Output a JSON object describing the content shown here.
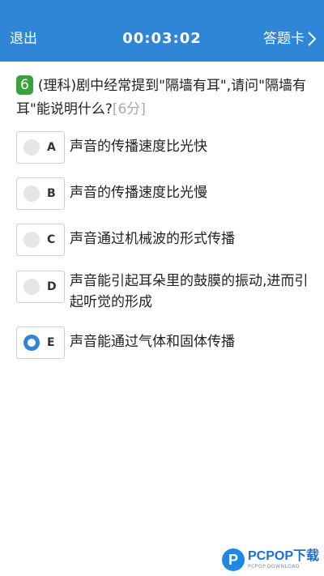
{
  "header": {
    "back_label": "退出",
    "timer": "00:03:02",
    "answer_sheet_label": "答题卡"
  },
  "question": {
    "number": "6",
    "text": "(理科)剧中经常提到\"隔墙有耳\",请问\"隔墙有耳\"能说明什么?",
    "score": "[6分]"
  },
  "options": [
    {
      "letter": "A",
      "text": "声音的传播速度比光快",
      "selected": false
    },
    {
      "letter": "B",
      "text": "声音的传播速度比光慢",
      "selected": false
    },
    {
      "letter": "C",
      "text": "声音通过机械波的形式传播",
      "selected": false
    },
    {
      "letter": "D",
      "text": "声音能引起耳朵里的鼓膜的振动,进而引起听觉的形成",
      "selected": false
    },
    {
      "letter": "E",
      "text": "声音能通过气体和固体传播",
      "selected": true
    }
  ],
  "watermark": {
    "badge": "P",
    "main": "PCPOP下载",
    "sub": "PCPOP.DOWNLOAD"
  },
  "colors": {
    "header_bg": "#2f86d6",
    "question_badge": "#3aa23a",
    "selected_radio": "#2f86d6",
    "score_text": "#a9a9a9"
  }
}
